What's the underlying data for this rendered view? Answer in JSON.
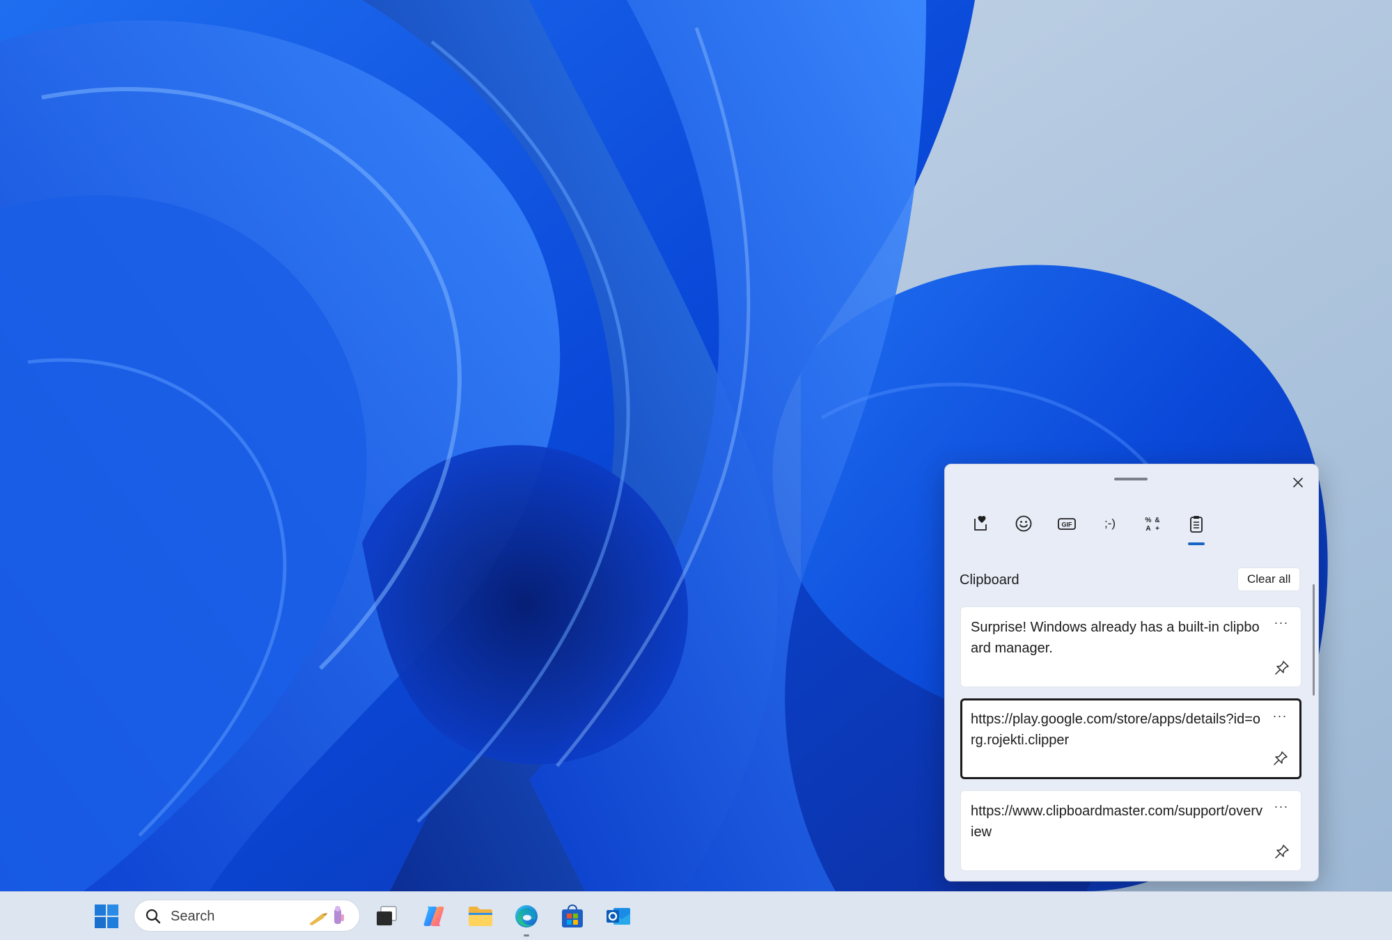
{
  "clipboard_panel": {
    "tabs": [
      {
        "icon": "favorites-heart-icon",
        "label": "Favorites"
      },
      {
        "icon": "emoji-icon",
        "label": "Emoji"
      },
      {
        "icon": "gif-icon",
        "label": "GIF"
      },
      {
        "icon": "kaomoji-icon",
        "label": ";-)"
      },
      {
        "icon": "symbols-icon",
        "label": "Symbols"
      },
      {
        "icon": "clipboard-icon",
        "label": "Clipboard"
      }
    ],
    "active_tab": "Clipboard",
    "section_title": "Clipboard",
    "clear_all_label": "Clear all",
    "items": [
      {
        "text": "Surprise! Windows already has a built-in clipboard manager.",
        "more": "···",
        "selected": false
      },
      {
        "text": "https://play.google.com/store/apps/details?id=org.rojekti.clipper",
        "more": "···",
        "selected": true
      },
      {
        "text": "https://www.clipboardmaster.com/support/overview",
        "more": "···",
        "selected": false
      }
    ],
    "accent_color": "#1a64c8"
  },
  "taskbar": {
    "search_placeholder": "Search",
    "apps": [
      "start-icon",
      "task-view-icon",
      "copilot-icon",
      "file-explorer-icon",
      "edge-icon",
      "microsoft-store-icon",
      "outlook-icon"
    ]
  }
}
